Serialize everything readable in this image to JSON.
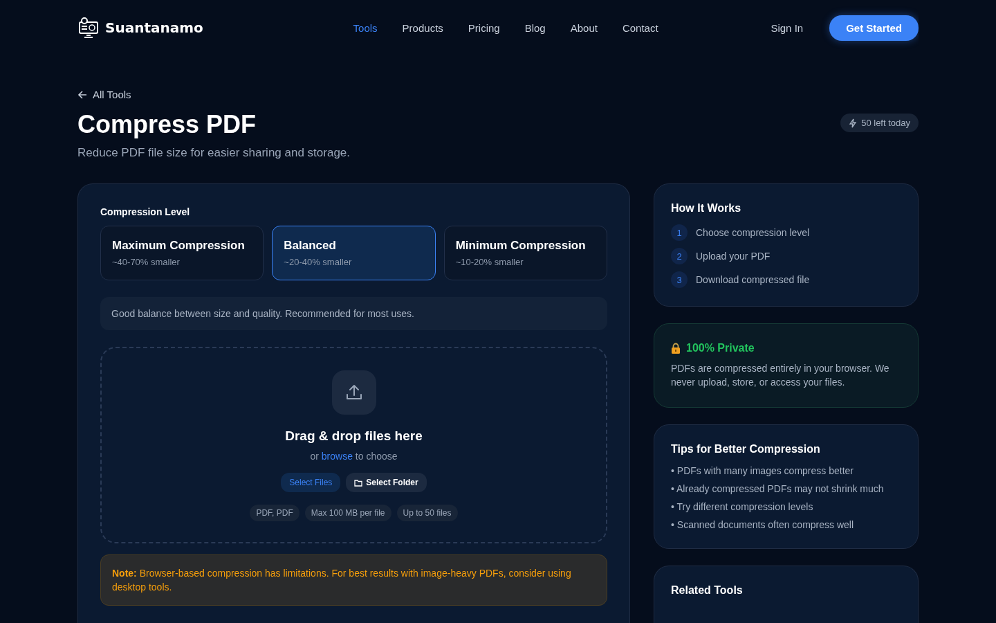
{
  "brand": {
    "name": "Suantanamo"
  },
  "nav": [
    {
      "label": "Tools",
      "selected": true
    },
    {
      "label": "Products",
      "selected": false
    },
    {
      "label": "Pricing",
      "selected": false
    },
    {
      "label": "Blog",
      "selected": false
    },
    {
      "label": "About",
      "selected": false
    },
    {
      "label": "Contact",
      "selected": false
    }
  ],
  "sign_in": "Sign In",
  "cta": "Get Started",
  "back_link": "All Tools",
  "title": "Compress PDF",
  "subtitle": "Reduce PDF file size for easier sharing and storage.",
  "quota": "50 left today",
  "compression": {
    "label": "Compression Level",
    "options": [
      {
        "name": "Maximum Compression",
        "detail": "~40-70% smaller",
        "selected": false
      },
      {
        "name": "Balanced",
        "detail": "~20-40% smaller",
        "selected": true
      },
      {
        "name": "Minimum Compression",
        "detail": "~10-20% smaller",
        "selected": false
      }
    ],
    "description": "Good balance between size and quality. Recommended for most uses."
  },
  "dropzone": {
    "heading": "Drag & drop files here",
    "or": "or",
    "browse": "browse",
    "to_choose": "to choose",
    "buttons": [
      {
        "label": "Select Files",
        "kind": "primary"
      },
      {
        "label": "Select Folder",
        "kind": "folder"
      }
    ],
    "chips": [
      "PDF, PDF",
      "Max 100 MB per file",
      "Up to 50 files"
    ]
  },
  "note": "**Note:** Browser-based compression has limitations. For best results with image-heavy PDFs, consider using desktop tools.",
  "how": {
    "title": "How It Works",
    "steps": [
      {
        "number": "1",
        "text": "Choose compression level"
      },
      {
        "number": "2",
        "text": "Upload your PDF"
      },
      {
        "number": "3",
        "text": "Download compressed file"
      }
    ]
  },
  "private": {
    "title": "100% Private",
    "text": "PDFs are compressed entirely in your browser. We never upload, store, or access your files."
  },
  "tips": {
    "title": "Tips for Better Compression",
    "items": [
      "• PDFs with many images compress better",
      "• Already compressed PDFs may not shrink much",
      "• Try different compression levels",
      "• Scanned documents often compress well"
    ]
  },
  "related": {
    "title": "Related Tools"
  }
}
